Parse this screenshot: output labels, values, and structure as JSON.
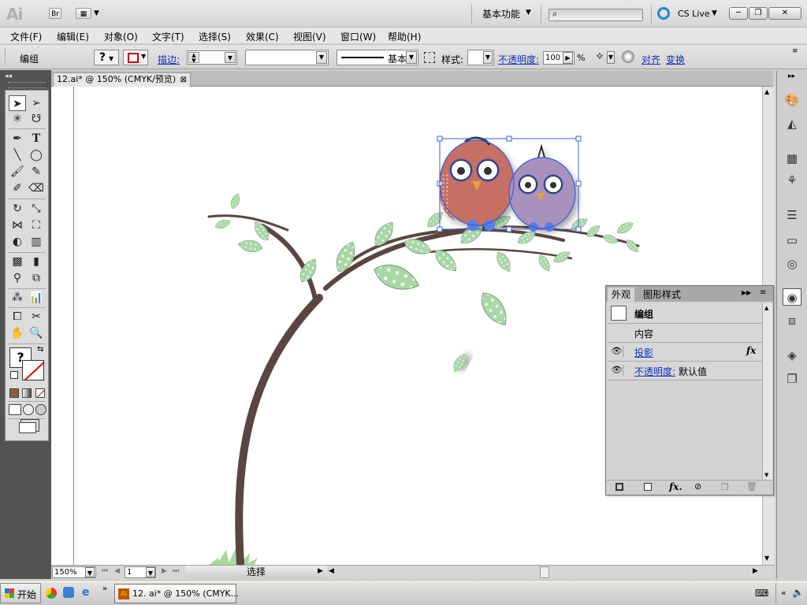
{
  "app": {
    "logo": "Ai",
    "bridge_label": "Br",
    "workspace": "基本功能",
    "cslive": "CS Live"
  },
  "window_buttons": {
    "minimize": "─",
    "maximize": "❐",
    "close": "✕"
  },
  "menubar": {
    "items": [
      {
        "label": "文件(F)"
      },
      {
        "label": "编辑(E)"
      },
      {
        "label": "对象(O)"
      },
      {
        "label": "文字(T)"
      },
      {
        "label": "选择(S)"
      },
      {
        "label": "效果(C)"
      },
      {
        "label": "视图(V)"
      },
      {
        "label": "窗口(W)"
      },
      {
        "label": "帮助(H)"
      }
    ]
  },
  "controlbar": {
    "selection_label": "编组",
    "stroke_link": "描边:",
    "stroke_style": "基本",
    "style_label": "样式:",
    "opacity_link": "不透明度:",
    "opacity_value": "100",
    "opacity_unit": "%",
    "align_link": "对齐",
    "transform_link": "变换"
  },
  "document": {
    "tab": "12.ai* @ 150% (CMYK/预览)",
    "tab_close": "⊠"
  },
  "statusbar": {
    "zoom": "150%",
    "artboard": "1",
    "tool_status": "选择"
  },
  "toolbox": {
    "question_mark": "?"
  },
  "appearance_panel": {
    "tabs": [
      "外观",
      "图形样式"
    ],
    "group_label": "编组",
    "contents_label": "内容",
    "effect_link": "投影",
    "fx_label": "fx",
    "opacity_link": "不透明度:",
    "opacity_value": "默认值"
  },
  "taskbar": {
    "start": "开始",
    "task": "12. ai* @ 150% (CMYK..."
  },
  "colors": {
    "branch": "#5a4540",
    "leaf": "#a9d8a7",
    "owl_red": "#c56f62",
    "owl_purple": "#a892bd",
    "selection": "#3b5dd8"
  }
}
